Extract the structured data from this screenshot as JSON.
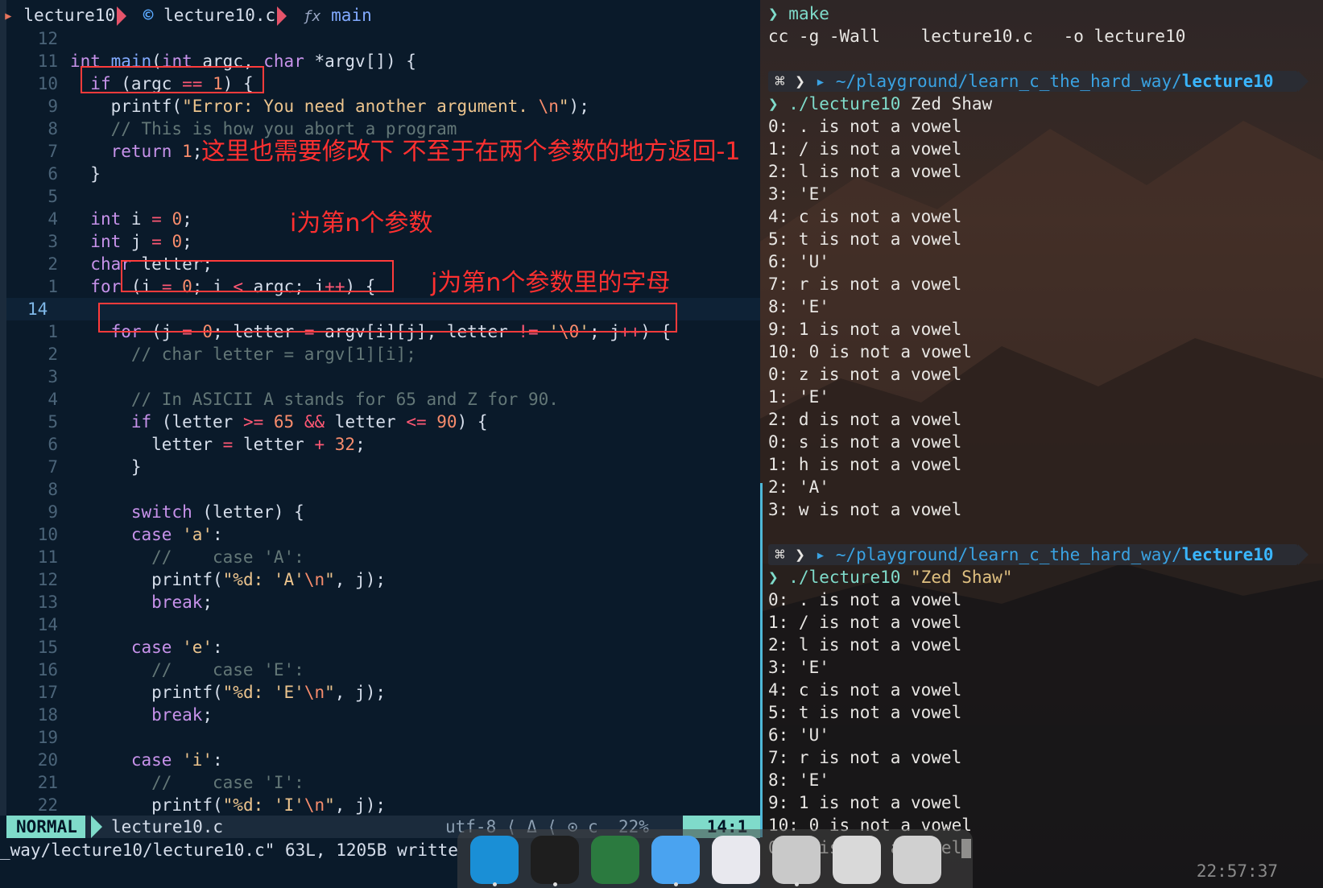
{
  "editor": {
    "winbar": {
      "folder": "lecture10",
      "file": "lecture10.c",
      "symbol": "main"
    },
    "lines": [
      {
        "ln": "12",
        "parts": []
      },
      {
        "ln": "11",
        "parts": [
          [
            "ty",
            "int "
          ],
          [
            "fn",
            "main"
          ],
          [
            "",
            "("
          ],
          [
            "ty",
            "int"
          ],
          [
            "",
            " argc, "
          ],
          [
            "ty",
            "char"
          ],
          [
            "",
            " *argv[]) {"
          ]
        ]
      },
      {
        "ln": "10",
        "parts": [
          [
            "",
            "  "
          ],
          [
            "kw",
            "if"
          ],
          [
            "",
            " (argc "
          ],
          [
            "op",
            "=="
          ],
          [
            "",
            " "
          ],
          [
            "num",
            "1"
          ],
          [
            "",
            ") {"
          ]
        ]
      },
      {
        "ln": "9",
        "parts": [
          [
            "",
            "    printf("
          ],
          [
            "str",
            "\"Error: You need another argument. "
          ],
          [
            "esc",
            "\\n"
          ],
          [
            "str",
            "\""
          ],
          [
            "",
            ");"
          ]
        ]
      },
      {
        "ln": "8",
        "parts": [
          [
            "cm",
            "    // This is how you abort a program"
          ]
        ]
      },
      {
        "ln": "7",
        "parts": [
          [
            "",
            "    "
          ],
          [
            "kw",
            "return"
          ],
          [
            "",
            " "
          ],
          [
            "num",
            "1"
          ],
          [
            "",
            ";"
          ]
        ]
      },
      {
        "ln": "6",
        "parts": [
          [
            "",
            "  }"
          ]
        ]
      },
      {
        "ln": "5",
        "parts": []
      },
      {
        "ln": "4",
        "parts": [
          [
            "",
            "  "
          ],
          [
            "ty",
            "int"
          ],
          [
            "",
            " i "
          ],
          [
            "op",
            "="
          ],
          [
            "",
            " "
          ],
          [
            "num",
            "0"
          ],
          [
            "",
            ";"
          ]
        ]
      },
      {
        "ln": "3",
        "parts": [
          [
            "",
            "  "
          ],
          [
            "ty",
            "int"
          ],
          [
            "",
            " j "
          ],
          [
            "op",
            "="
          ],
          [
            "",
            " "
          ],
          [
            "num",
            "0"
          ],
          [
            "",
            ";"
          ]
        ]
      },
      {
        "ln": "2",
        "parts": [
          [
            "",
            "  "
          ],
          [
            "ty",
            "char"
          ],
          [
            "",
            " letter;"
          ]
        ]
      },
      {
        "ln": "1",
        "parts": [
          [
            "",
            "  "
          ],
          [
            "kw",
            "for"
          ],
          [
            "",
            " (i "
          ],
          [
            "op",
            "="
          ],
          [
            "",
            " "
          ],
          [
            "num",
            "0"
          ],
          [
            "",
            "; i "
          ],
          [
            "op",
            "<"
          ],
          [
            "",
            " argc; i"
          ],
          [
            "op",
            "++"
          ],
          [
            "",
            ") {"
          ]
        ]
      },
      {
        "ln": "14",
        "cursor": true,
        "parts": []
      },
      {
        "ln": "1",
        "parts": [
          [
            "",
            "    "
          ],
          [
            "kw",
            "for"
          ],
          [
            "",
            " (j "
          ],
          [
            "op",
            "="
          ],
          [
            "",
            " "
          ],
          [
            "num",
            "0"
          ],
          [
            "",
            "; letter "
          ],
          [
            "op",
            "="
          ],
          [
            "",
            " argv[i][j], letter "
          ],
          [
            "op",
            "!="
          ],
          [
            "",
            " "
          ],
          [
            "str",
            "'"
          ],
          [
            "esc",
            "\\0"
          ],
          [
            "str",
            "'"
          ],
          [
            "",
            "; j"
          ],
          [
            "op",
            "++"
          ],
          [
            "",
            ") {"
          ]
        ]
      },
      {
        "ln": "2",
        "parts": [
          [
            "cm",
            "      // char letter = argv[1][i];"
          ]
        ]
      },
      {
        "ln": "3",
        "parts": []
      },
      {
        "ln": "4",
        "parts": [
          [
            "cm",
            "      // In ASICII A stands for 65 and Z for 90."
          ]
        ]
      },
      {
        "ln": "5",
        "parts": [
          [
            "",
            "      "
          ],
          [
            "kw",
            "if"
          ],
          [
            "",
            " (letter "
          ],
          [
            "op",
            ">="
          ],
          [
            "",
            " "
          ],
          [
            "num",
            "65"
          ],
          [
            "",
            " "
          ],
          [
            "op",
            "&&"
          ],
          [
            "",
            " letter "
          ],
          [
            "op",
            "<="
          ],
          [
            "",
            " "
          ],
          [
            "num",
            "90"
          ],
          [
            "",
            ") {"
          ]
        ]
      },
      {
        "ln": "6",
        "parts": [
          [
            "",
            "        letter "
          ],
          [
            "op",
            "="
          ],
          [
            "",
            " letter "
          ],
          [
            "op",
            "+"
          ],
          [
            "",
            " "
          ],
          [
            "num",
            "32"
          ],
          [
            "",
            ";"
          ]
        ]
      },
      {
        "ln": "7",
        "parts": [
          [
            "",
            "      }"
          ]
        ]
      },
      {
        "ln": "8",
        "parts": []
      },
      {
        "ln": "9",
        "parts": [
          [
            "",
            "      "
          ],
          [
            "kw",
            "switch"
          ],
          [
            "",
            " (letter) {"
          ]
        ]
      },
      {
        "ln": "10",
        "parts": [
          [
            "",
            "      "
          ],
          [
            "kw",
            "case"
          ],
          [
            "",
            " "
          ],
          [
            "str",
            "'a'"
          ],
          [
            "",
            ":"
          ]
        ]
      },
      {
        "ln": "11",
        "parts": [
          [
            "cm",
            "        //    case 'A':"
          ]
        ]
      },
      {
        "ln": "12",
        "parts": [
          [
            "",
            "        printf("
          ],
          [
            "str",
            "\"%d: 'A'"
          ],
          [
            "esc",
            "\\n"
          ],
          [
            "str",
            "\""
          ],
          [
            "",
            ", j);"
          ]
        ]
      },
      {
        "ln": "13",
        "parts": [
          [
            "",
            "        "
          ],
          [
            "kw",
            "break"
          ],
          [
            "",
            ";"
          ]
        ]
      },
      {
        "ln": "14",
        "parts": []
      },
      {
        "ln": "15",
        "parts": [
          [
            "",
            "      "
          ],
          [
            "kw",
            "case"
          ],
          [
            "",
            " "
          ],
          [
            "str",
            "'e'"
          ],
          [
            "",
            ":"
          ]
        ]
      },
      {
        "ln": "16",
        "parts": [
          [
            "cm",
            "        //    case 'E':"
          ]
        ]
      },
      {
        "ln": "17",
        "parts": [
          [
            "",
            "        printf("
          ],
          [
            "str",
            "\"%d: 'E'"
          ],
          [
            "esc",
            "\\n"
          ],
          [
            "str",
            "\""
          ],
          [
            "",
            ", j);"
          ]
        ]
      },
      {
        "ln": "18",
        "parts": [
          [
            "",
            "        "
          ],
          [
            "kw",
            "break"
          ],
          [
            "",
            ";"
          ]
        ]
      },
      {
        "ln": "19",
        "parts": []
      },
      {
        "ln": "20",
        "parts": [
          [
            "",
            "      "
          ],
          [
            "kw",
            "case"
          ],
          [
            "",
            " "
          ],
          [
            "str",
            "'i'"
          ],
          [
            "",
            ":"
          ]
        ]
      },
      {
        "ln": "21",
        "parts": [
          [
            "cm",
            "        //    case 'I':"
          ]
        ]
      },
      {
        "ln": "22",
        "parts": [
          [
            "",
            "        printf("
          ],
          [
            "str",
            "\"%d: 'I'"
          ],
          [
            "esc",
            "\\n"
          ],
          [
            "str",
            "\""
          ],
          [
            "",
            ", j);"
          ]
        ]
      }
    ],
    "annotations": {
      "note1": "这里也需要修改下 不至于在两个参数的地方返回-1",
      "note2": "i为第n个参数",
      "note3": "j为第n个参数里的字母"
    },
    "status": {
      "mode": "NORMAL",
      "file": "lecture10.c",
      "encoding": "utf-8 ⟨ Δ ⟨ ⊙ c",
      "percent": "22%",
      "position": "14:1"
    },
    "cmdline": "_way/lecture10/lecture10.c\" 63L, 1205B writte"
  },
  "terminal": {
    "lines": [
      {
        "type": "cmd",
        "text": "make"
      },
      {
        "type": "out",
        "text": "cc -g -Wall    lecture10.c   -o lecture10"
      },
      {
        "type": "blank",
        "text": ""
      },
      {
        "type": "prompt",
        "path": "~/playground/learn_c_the_hard_way/",
        "dir": "lecture10"
      },
      {
        "type": "run",
        "cmd": "./lecture10",
        "args": "Zed Shaw",
        "quoted": false
      },
      {
        "type": "out",
        "text": "0: . is not a vowel"
      },
      {
        "type": "out",
        "text": "1: / is not a vowel"
      },
      {
        "type": "out",
        "text": "2: l is not a vowel"
      },
      {
        "type": "out",
        "text": "3: 'E'"
      },
      {
        "type": "out",
        "text": "4: c is not a vowel"
      },
      {
        "type": "out",
        "text": "5: t is not a vowel"
      },
      {
        "type": "out",
        "text": "6: 'U'"
      },
      {
        "type": "out",
        "text": "7: r is not a vowel"
      },
      {
        "type": "out",
        "text": "8: 'E'"
      },
      {
        "type": "out",
        "text": "9: 1 is not a vowel"
      },
      {
        "type": "out",
        "text": "10: 0 is not a vowel"
      },
      {
        "type": "out",
        "text": "0: z is not a vowel"
      },
      {
        "type": "out",
        "text": "1: 'E'"
      },
      {
        "type": "out",
        "text": "2: d is not a vowel"
      },
      {
        "type": "out",
        "text": "0: s is not a vowel"
      },
      {
        "type": "out",
        "text": "1: h is not a vowel"
      },
      {
        "type": "out",
        "text": "2: 'A'"
      },
      {
        "type": "out",
        "text": "3: w is not a vowel"
      },
      {
        "type": "blank",
        "text": ""
      },
      {
        "type": "prompt",
        "path": "~/playground/learn_c_the_hard_way/",
        "dir": "lecture10"
      },
      {
        "type": "run",
        "cmd": "./lecture10",
        "args": "\"Zed Shaw\"",
        "quoted": true
      },
      {
        "type": "out",
        "text": "0: . is not a vowel"
      },
      {
        "type": "out",
        "text": "1: / is not a vowel"
      },
      {
        "type": "out",
        "text": "2: l is not a vowel"
      },
      {
        "type": "out",
        "text": "3: 'E'"
      },
      {
        "type": "out",
        "text": "4: c is not a vowel"
      },
      {
        "type": "out",
        "text": "5: t is not a vowel"
      },
      {
        "type": "out",
        "text": "6: 'U'"
      },
      {
        "type": "out",
        "text": "7: r is not a vowel"
      },
      {
        "type": "out",
        "text": "8: 'E'"
      },
      {
        "type": "out",
        "text": "9: 1 is not a vowel"
      },
      {
        "type": "out",
        "text": "10: 0 is not a vowel"
      },
      {
        "type": "out",
        "text": "0: s is not a vowel"
      }
    ],
    "clock": "22:57:37"
  },
  "dock": {
    "apps": [
      {
        "name": "edge-app-icon",
        "color": "#1a8fd6"
      },
      {
        "name": "terminal-app-icon",
        "color": "#1e1e1e"
      },
      {
        "name": "neovim-app-icon",
        "color": "#2b7a3f"
      },
      {
        "name": "finder-app-icon",
        "color": "#4aa3f0"
      },
      {
        "name": "settings-toggle-app-icon",
        "color": "#e8e8ee"
      },
      {
        "name": "java-app-icon",
        "color": "#c9c9c9"
      },
      {
        "name": "trash-app-icon",
        "color": "#d9d9d9"
      },
      {
        "name": "launchpad-app-icon",
        "color": "#d0d0d0"
      }
    ]
  },
  "colors": {
    "annotation": "#ff3030",
    "mode_bg": "#7fdbca",
    "prompt_dir": "#3ab6ff"
  }
}
